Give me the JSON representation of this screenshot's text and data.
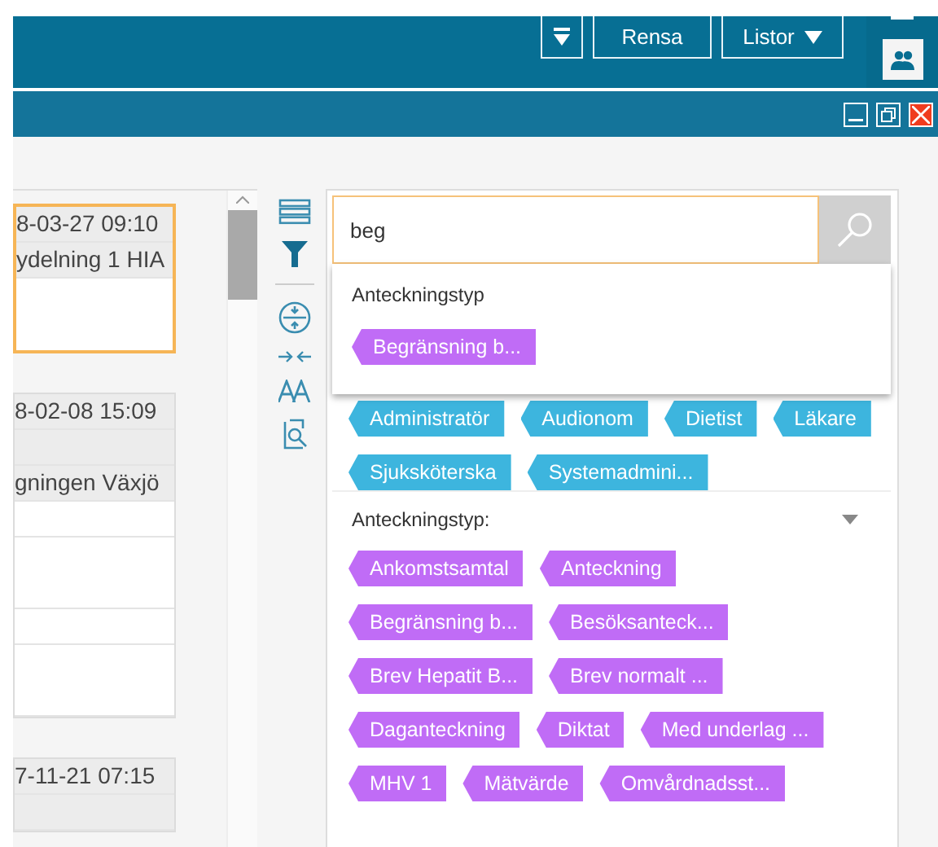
{
  "header": {
    "buttons": [
      {
        "kind": "icon"
      },
      {
        "kind": "text",
        "label": "Rensa"
      },
      {
        "kind": "menu",
        "label": "Listor"
      }
    ]
  },
  "cards": [
    {
      "selected": true,
      "rows": [
        {
          "kind": "head",
          "text": "8-03-27 09:10"
        },
        {
          "kind": "head",
          "text": "ydelning 1 HIA"
        },
        {
          "kind": "blank"
        },
        {
          "kind": "blank"
        }
      ]
    },
    {
      "selected": false,
      "rows": [
        {
          "kind": "head",
          "text": "8-02-08 15:09"
        },
        {
          "kind": "grey"
        },
        {
          "kind": "head",
          "text": "gningen Växjö"
        },
        {
          "kind": "line"
        },
        {
          "kind": "blank"
        },
        {
          "kind": "line"
        },
        {
          "kind": "line"
        },
        {
          "kind": "blank"
        },
        {
          "kind": "line"
        }
      ]
    },
    {
      "selected": false,
      "rows": [
        {
          "kind": "head",
          "text": "7-11-21 07:15"
        },
        {
          "kind": "grey"
        }
      ]
    }
  ],
  "search": {
    "value": "beg"
  },
  "suggestions": {
    "heading": "Anteckningstyp",
    "tags": [
      "Begränsning b..."
    ]
  },
  "sections": [
    {
      "color": "#3db5de",
      "tags": [
        "Administratör",
        "Audionom",
        "Dietist",
        "Läkare",
        "Sjuksköterska",
        "Systemadmini..."
      ]
    },
    {
      "title": "Anteckningstyp:",
      "expanded": true,
      "color": "#c06cf6",
      "tags": [
        "Ankomstsamtal",
        "Anteckning",
        "Begränsning b...",
        "Besöksanteck...",
        "Brev Hepatit B...",
        "Brev normalt ...",
        "Daganteckning",
        "Diktat",
        "Med underlag ...",
        "MHV 1",
        "Mätvärde",
        "Omvårdnadsst..."
      ]
    }
  ]
}
